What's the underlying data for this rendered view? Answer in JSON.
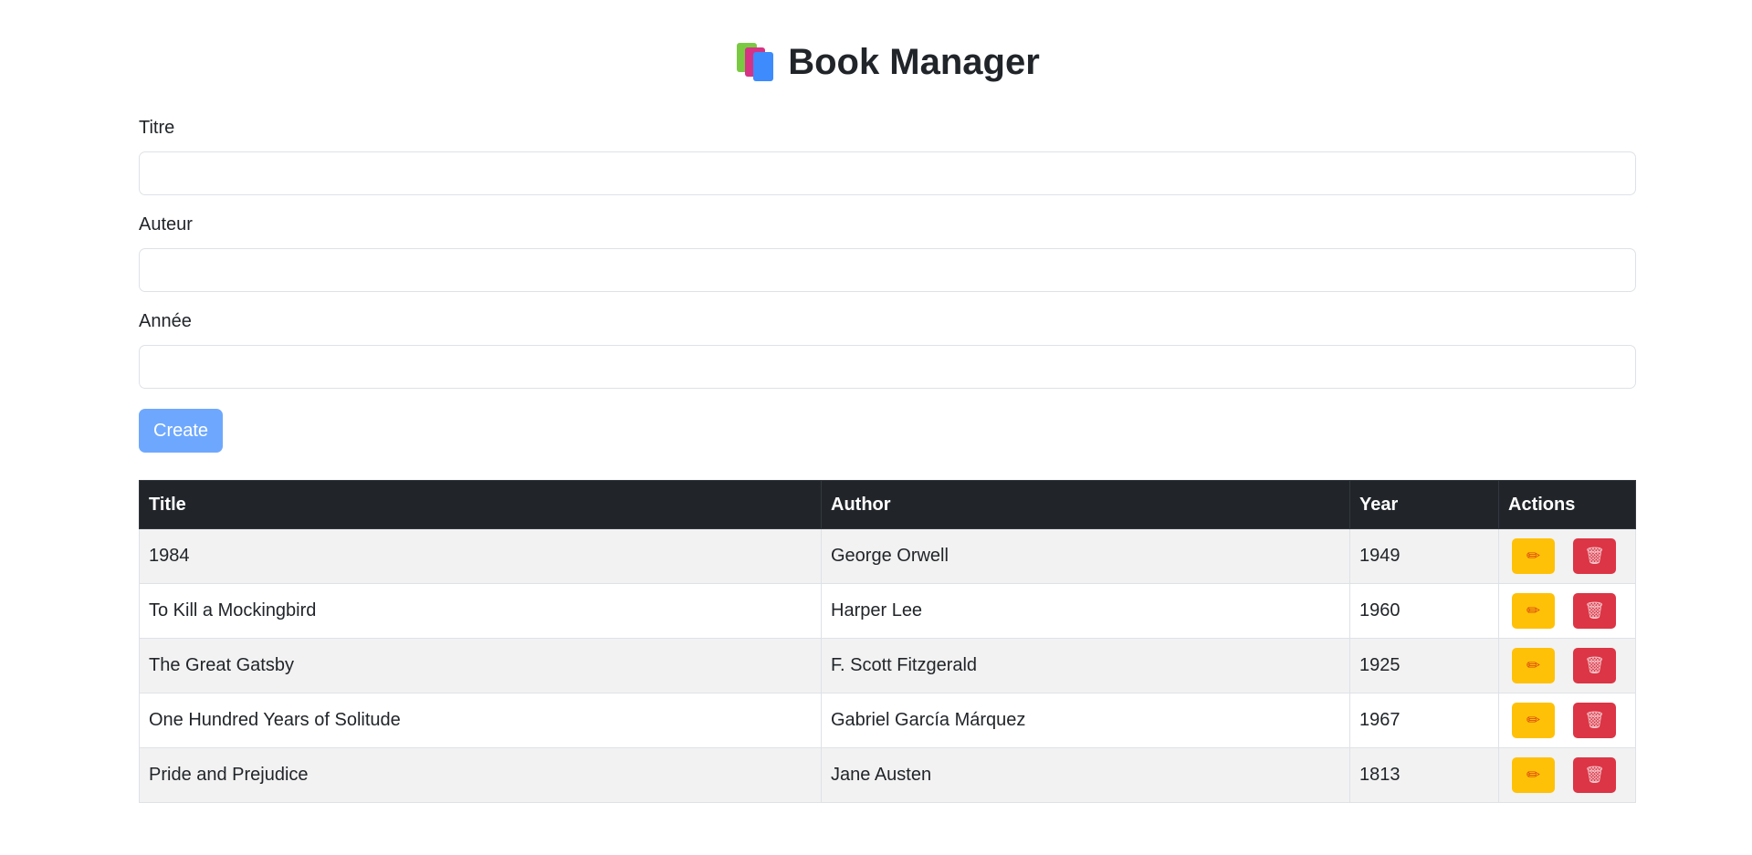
{
  "header": {
    "icon": "books-icon",
    "title": "Book Manager"
  },
  "form": {
    "title_label": "Titre",
    "title_value": "",
    "author_label": "Auteur",
    "author_value": "",
    "year_label": "Année",
    "year_value": "",
    "create_label": "Create"
  },
  "table": {
    "headers": [
      "Title",
      "Author",
      "Year",
      "Actions"
    ],
    "rows": [
      {
        "title": "1984",
        "author": "George Orwell",
        "year": "1949"
      },
      {
        "title": "To Kill a Mockingbird",
        "author": "Harper Lee",
        "year": "1960"
      },
      {
        "title": "The Great Gatsby",
        "author": "F. Scott Fitzgerald",
        "year": "1925"
      },
      {
        "title": "One Hundred Years of Solitude",
        "author": "Gabriel García Márquez",
        "year": "1967"
      },
      {
        "title": "Pride and Prejudice",
        "author": "Jane Austen",
        "year": "1813"
      }
    ],
    "edit_icon": "✏",
    "delete_icon": "🗑"
  },
  "colors": {
    "create_button": "#6ea8fe",
    "edit_button": "#ffc107",
    "delete_button": "#dc3545",
    "table_header": "#212529"
  }
}
